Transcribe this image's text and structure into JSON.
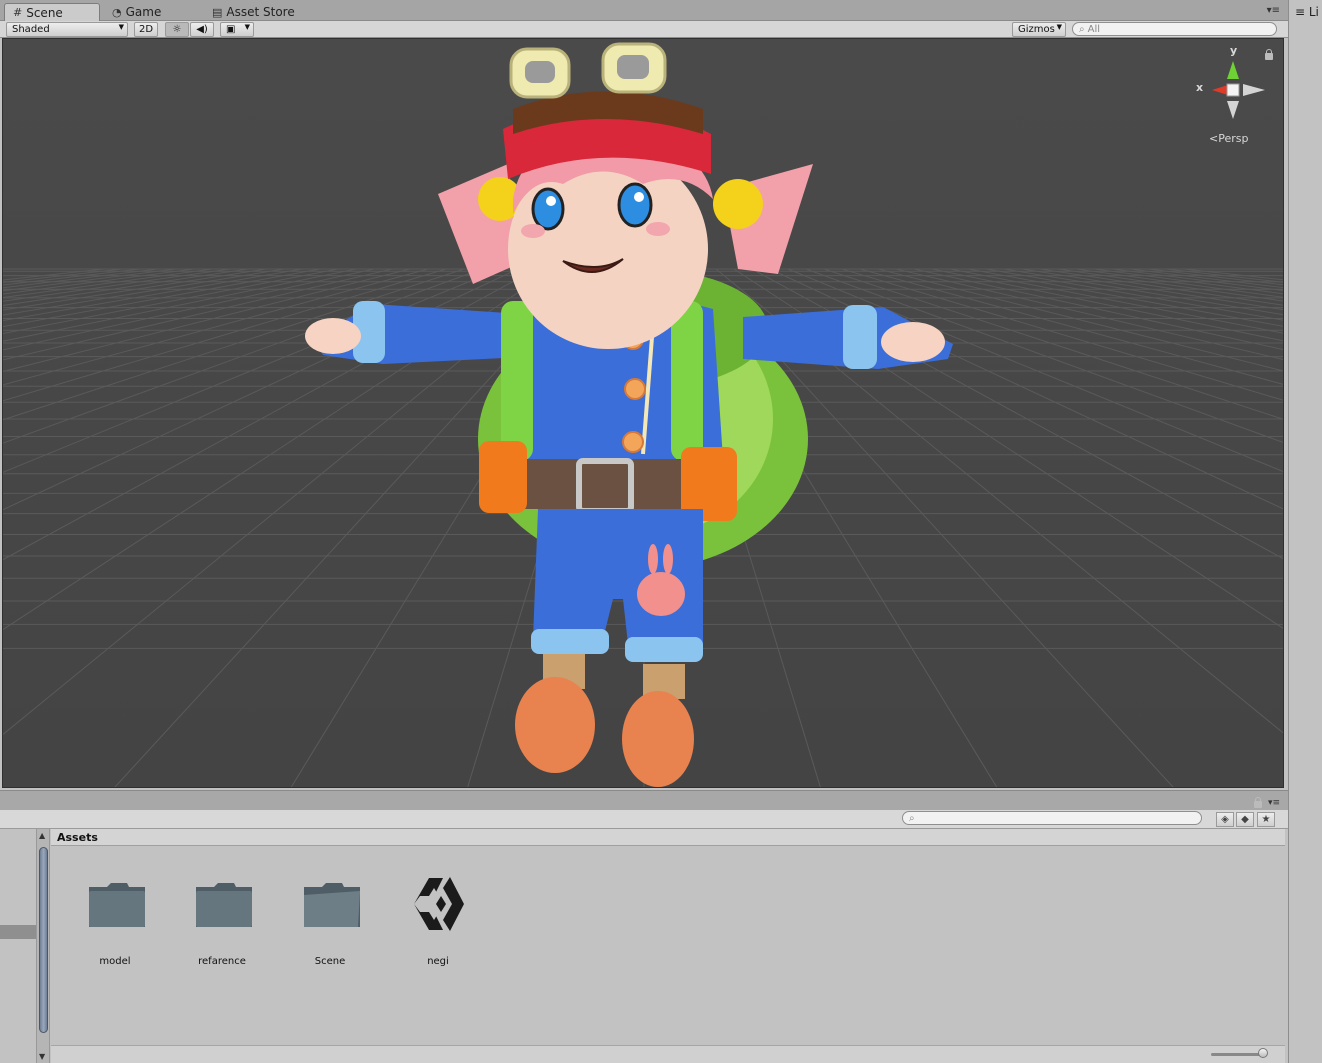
{
  "tabs": [
    {
      "label": "Scene",
      "icon": "grid-icon"
    },
    {
      "label": "Game",
      "icon": "pacman-icon"
    },
    {
      "label": "Asset Store",
      "icon": "store-icon"
    }
  ],
  "side_tab_label": "Li",
  "toolbar": {
    "shading_mode": "Shaded",
    "toggle_2d": "2D",
    "gizmos_label": "Gizmos",
    "search_placeholder": "All"
  },
  "scene_gizmo": {
    "y_label": "y",
    "x_label": "x",
    "projection_label": "Persp"
  },
  "project": {
    "breadcrumb": "Assets",
    "items": [
      {
        "label": "model",
        "type": "folder"
      },
      {
        "label": "refarence",
        "type": "folder"
      },
      {
        "label": "Scene",
        "type": "folder"
      },
      {
        "label": "negi",
        "type": "unity-scene"
      }
    ]
  },
  "colors": {
    "viewport_bg": "#474747",
    "grid_line": "#5a5a5a",
    "axis_y": "#6fd234",
    "axis_x": "#e03a28"
  }
}
